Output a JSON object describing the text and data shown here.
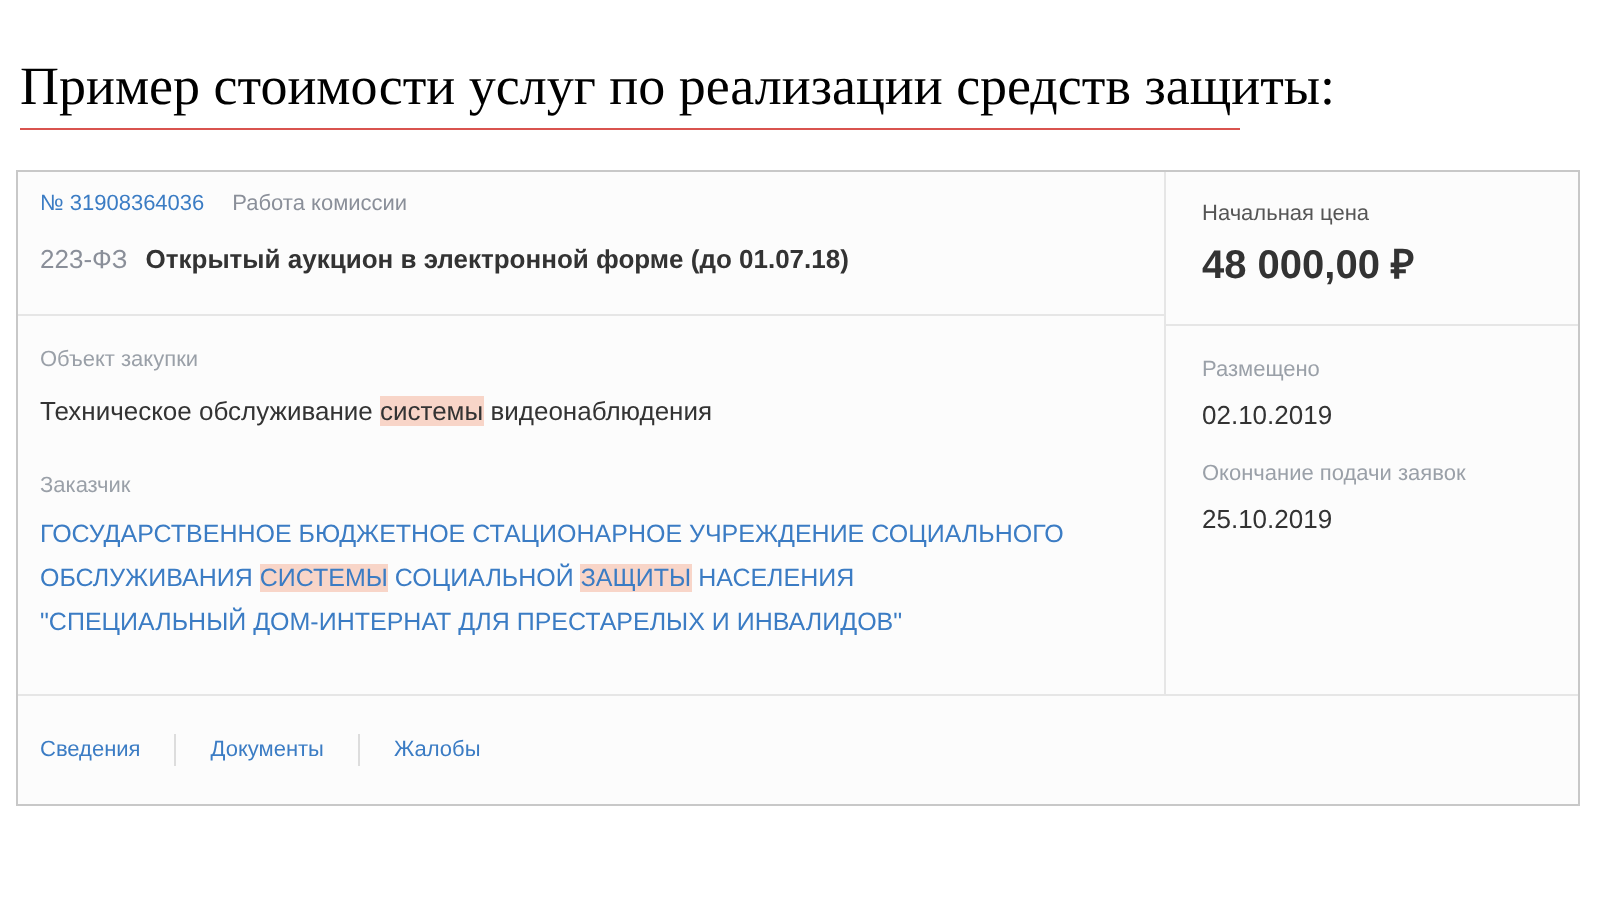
{
  "slide_title": "Пример стоимости услуг по реализации средств защиты:",
  "card": {
    "number": "№ 31908364036",
    "stage": "Работа комиссии",
    "law": "223-ФЗ",
    "procedure": "Открытый аукцион в электронной форме (до 01.07.18)",
    "object_label": "Объект закупки",
    "object_segments": [
      {
        "text": "Техническое обслуживание ",
        "highlighted": false
      },
      {
        "text": "системы",
        "highlighted": true
      },
      {
        "text": " видеонаблюдения",
        "highlighted": false
      }
    ],
    "customer_label": "Заказчик",
    "customer_lines": [
      [
        {
          "text": "ГОСУДАРСТВЕННОЕ БЮДЖЕТНОЕ СТАЦИОНАРНОЕ УЧРЕЖДЕНИЕ СОЦИАЛЬНОГО",
          "highlighted": false
        }
      ],
      [
        {
          "text": "ОБСЛУЖИВАНИЯ ",
          "highlighted": false
        },
        {
          "text": "СИСТЕМЫ",
          "highlighted": true
        },
        {
          "text": " СОЦИАЛЬНОЙ ",
          "highlighted": false
        },
        {
          "text": "ЗАЩИТЫ",
          "highlighted": true
        },
        {
          "text": " НАСЕЛЕНИЯ",
          "highlighted": false
        }
      ],
      [
        {
          "text": "\"СПЕЦИАЛЬНЫЙ ДОМ-ИНТЕРНАТ ДЛЯ ПРЕСТАРЕЛЫХ И ИНВАЛИДОВ\"",
          "highlighted": false
        }
      ]
    ],
    "price_label": "Начальная цена",
    "price": "48 000,00 ₽",
    "dates": [
      {
        "label": "Размещено",
        "value": "02.10.2019"
      },
      {
        "label": "Окончание подачи заявок",
        "value": "25.10.2019"
      }
    ],
    "tabs": [
      "Сведения",
      "Документы",
      "Жалобы"
    ]
  }
}
